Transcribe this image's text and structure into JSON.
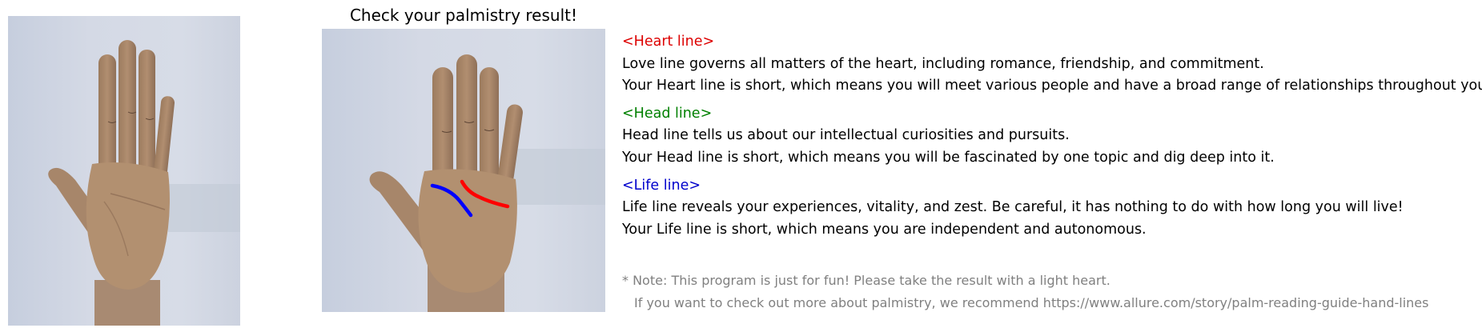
{
  "title": "Check your palmistry result!",
  "images": {
    "original": {
      "icon": "palm-photo"
    },
    "annotated": {
      "icon": "palm-photo-annotated",
      "line_colors": {
        "heart": "#ff0000",
        "life": "#0000ff"
      }
    }
  },
  "heart": {
    "heading": "<Heart line>",
    "color": "#dd0000",
    "description": "Love line governs all matters of the heart, including romance, friendship, and commitment.",
    "result": "Your Heart line is short, which means you will meet various people and have a broad range of relationships throughout your life."
  },
  "head": {
    "heading": "<Head line>",
    "color": "#008000",
    "description": "Head line tells us about our intellectual curiosities and pursuits.",
    "result": "Your Head line is short, which means you will be fascinated by one topic and dig deep into it."
  },
  "life": {
    "heading": "<Life line>",
    "color": "#0000cc",
    "description": "Life line reveals your experiences, vitality, and zest. Be careful, it has nothing to do with how long you will live!",
    "result": "Your Life line is short, which means you are independent and autonomous."
  },
  "note": {
    "line1": "* Note: This program is just for fun! Please take the result with a light heart.",
    "line2": "If you want to check out more about palmistry, we recommend https://www.allure.com/story/palm-reading-guide-hand-lines"
  }
}
